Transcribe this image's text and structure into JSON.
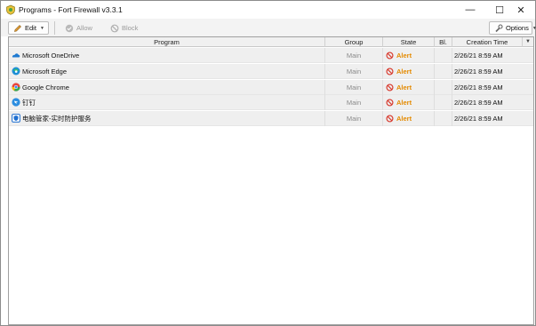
{
  "window": {
    "title": "Programs - Fort Firewall v3.3.1",
    "minimize_glyph": "—",
    "maximize_glyph": "☐",
    "close_glyph": "✕"
  },
  "toolbar": {
    "edit_label": "Edit",
    "allow_label": "Allow",
    "block_label": "Block",
    "options_label": "Options"
  },
  "table": {
    "columns": [
      "Program",
      "Group",
      "State",
      "Bl.",
      "Creation Time"
    ],
    "rows": [
      {
        "icon": "onedrive-icon",
        "program": "Microsoft OneDrive",
        "group": "Main",
        "state": "Alert",
        "bl": "",
        "time": "2/26/21 8:59 AM"
      },
      {
        "icon": "edge-icon",
        "program": "Microsoft Edge",
        "group": "Main",
        "state": "Alert",
        "bl": "",
        "time": "2/26/21 8:59 AM"
      },
      {
        "icon": "chrome-icon",
        "program": "Google Chrome",
        "group": "Main",
        "state": "Alert",
        "bl": "",
        "time": "2/26/21 8:59 AM"
      },
      {
        "icon": "dingtalk-icon",
        "program": "钉钉",
        "group": "Main",
        "state": "Alert",
        "bl": "",
        "time": "2/26/21 8:59 AM"
      },
      {
        "icon": "pc-manager-icon",
        "program": "电脑管家-实时防护服务",
        "group": "Main",
        "state": "Alert",
        "bl": "",
        "time": "2/26/21 8:59 AM"
      }
    ]
  },
  "colors": {
    "alert": "#e48a00",
    "block_red": "#d83a2e",
    "row_bg": "#efefef"
  }
}
